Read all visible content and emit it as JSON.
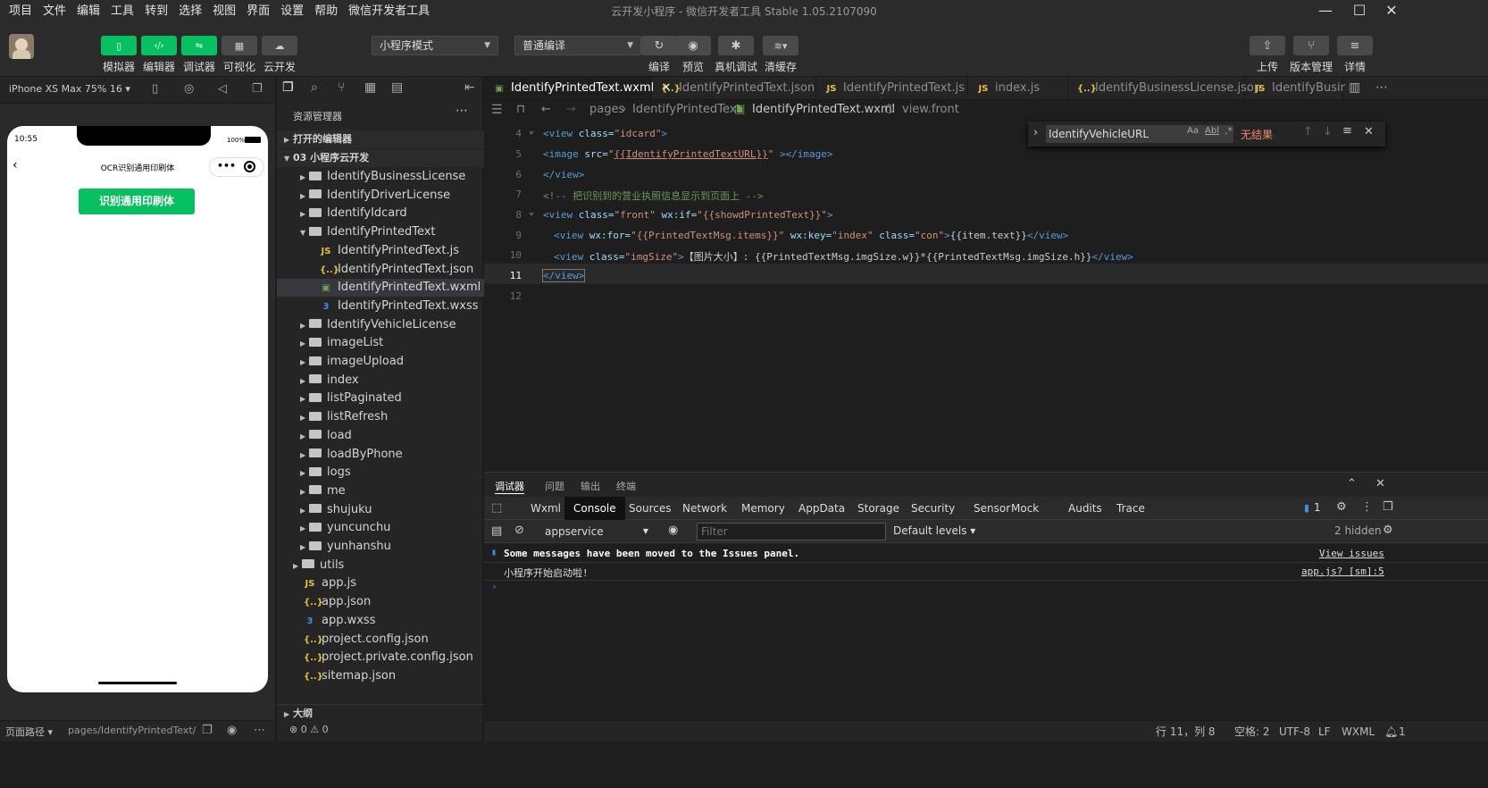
{
  "menu": [
    "项目",
    "文件",
    "编辑",
    "工具",
    "转到",
    "选择",
    "视图",
    "界面",
    "设置",
    "帮助",
    "微信开发者工具"
  ],
  "window_title": "云开发小程序 - 微信开发者工具 Stable 1.05.2107090",
  "toolbar": {
    "left_buttons": [
      "模拟器",
      "编辑器",
      "调试器",
      "可视化",
      "云开发"
    ],
    "mode_select": "小程序模式",
    "compile_select": "普通编译",
    "mid_buttons": [
      "编译",
      "预览",
      "真机调试",
      "清缓存"
    ],
    "right_buttons": [
      "上传",
      "版本管理",
      "详情"
    ]
  },
  "simulator": {
    "device": "iPhone XS Max 75% 16 ▾",
    "time": "10:55",
    "battery": "100%",
    "page_title": "OCR识别通用印刷体",
    "button": "识别通用印刷体",
    "footer_path_label": "页面路径 ▾",
    "footer_path": "pages/IdentifyPrintedText/I..."
  },
  "explorer": {
    "title": "资源管理器",
    "open_editors": "打开的编辑器",
    "project": "03 小程序云开发",
    "outline": "大纲",
    "status": "⊗ 0 ⚠ 0",
    "items": [
      {
        "label": "IdentifyBusinessLicense",
        "type": "folder",
        "depth": 1
      },
      {
        "label": "IdentifyDriverLicense",
        "type": "folder",
        "depth": 1
      },
      {
        "label": "IdentifyIdcard",
        "type": "folder",
        "depth": 1
      },
      {
        "label": "IdentifyPrintedText",
        "type": "folder-open",
        "depth": 1
      },
      {
        "label": "IdentifyPrintedText.js",
        "type": "js",
        "depth": 2
      },
      {
        "label": "IdentifyPrintedText.json",
        "type": "json",
        "depth": 2
      },
      {
        "label": "IdentifyPrintedText.wxml",
        "type": "wxml",
        "depth": 2,
        "selected": true
      },
      {
        "label": "IdentifyPrintedText.wxss",
        "type": "wxss",
        "depth": 2
      },
      {
        "label": "IdentifyVehicleLicense",
        "type": "folder",
        "depth": 1
      },
      {
        "label": "imageList",
        "type": "folder",
        "depth": 1
      },
      {
        "label": "imageUpload",
        "type": "folder",
        "depth": 1
      },
      {
        "label": "index",
        "type": "folder",
        "depth": 1
      },
      {
        "label": "listPaginated",
        "type": "folder",
        "depth": 1
      },
      {
        "label": "listRefresh",
        "type": "folder",
        "depth": 1
      },
      {
        "label": "load",
        "type": "folder",
        "depth": 1
      },
      {
        "label": "loadByPhone",
        "type": "folder",
        "depth": 1
      },
      {
        "label": "logs",
        "type": "folder",
        "depth": 1
      },
      {
        "label": "me",
        "type": "folder",
        "depth": 1
      },
      {
        "label": "shujuku",
        "type": "folder",
        "depth": 1
      },
      {
        "label": "yuncunchu",
        "type": "folder",
        "depth": 1
      },
      {
        "label": "yunhanshu",
        "type": "folder",
        "depth": 1
      },
      {
        "label": "utils",
        "type": "folder",
        "depth": 0
      },
      {
        "label": "app.js",
        "type": "js",
        "depth": 0
      },
      {
        "label": "app.json",
        "type": "json",
        "depth": 0
      },
      {
        "label": "app.wxss",
        "type": "wxss",
        "depth": 0
      },
      {
        "label": "project.config.json",
        "type": "json",
        "depth": 0
      },
      {
        "label": "project.private.config.json",
        "type": "json",
        "depth": 0
      },
      {
        "label": "sitemap.json",
        "type": "json",
        "depth": 0
      }
    ]
  },
  "tabs": [
    {
      "label": "IdentifyPrintedText.wxml",
      "type": "wxml",
      "active": true
    },
    {
      "label": "IdentifyPrintedText.json",
      "type": "json"
    },
    {
      "label": "IdentifyPrintedText.js",
      "type": "js"
    },
    {
      "label": "index.js",
      "type": "js"
    },
    {
      "label": "IdentifyBusinessLicense.json",
      "type": "json"
    },
    {
      "label": "IdentifyBusir",
      "type": "js"
    }
  ],
  "breadcrumb": [
    "pages",
    "IdentifyPrintedText",
    "IdentifyPrintedText.wxml",
    "view.front"
  ],
  "find": {
    "query": "IdentifyVehicleURL",
    "result": "无结果"
  },
  "code_lines": [
    "4",
    "5",
    "6",
    "7",
    "8",
    "9",
    "10",
    "11",
    "12"
  ],
  "devtools": {
    "panel_tabs": [
      "调试器",
      "问题",
      "输出",
      "终端"
    ],
    "tabs": [
      "Wxml",
      "Console",
      "Sources",
      "Network",
      "Memory",
      "AppData",
      "Storage",
      "Security",
      "Sensor",
      "Mock",
      "Audits",
      "Trace"
    ],
    "active_tab": "Console",
    "badge": "1",
    "context": "appservice",
    "filter_placeholder": "Filter",
    "levels": "Default levels ▾",
    "hidden": "2 hidden",
    "messages": [
      {
        "text": "Some messages have been moved to the Issues panel.",
        "link": "View issues"
      },
      {
        "text": "小程序开始启动啦!",
        "link": "app.js? [sm]:5"
      }
    ]
  },
  "status": {
    "position": "行 11，列 8",
    "spaces": "空格: 2",
    "encoding": "UTF-8",
    "eol": "LF",
    "lang": "WXML",
    "bell": "1"
  }
}
